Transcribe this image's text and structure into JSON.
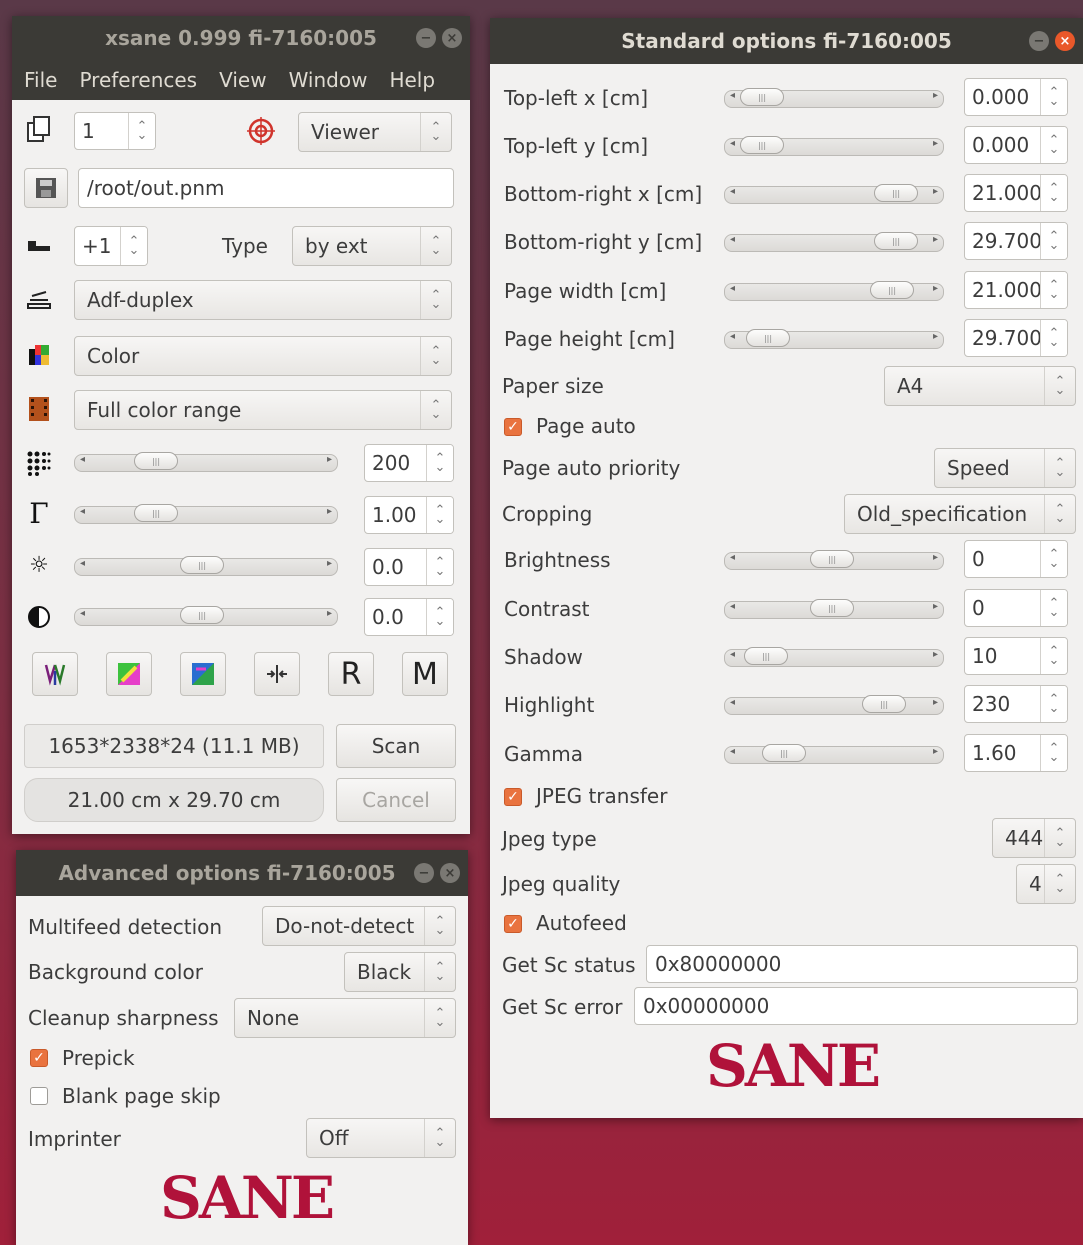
{
  "main": {
    "title": "xsane 0.999 fi-7160:005",
    "menu": [
      "File",
      "Preferences",
      "View",
      "Window",
      "Help"
    ],
    "copies": "1",
    "viewer": "Viewer",
    "filename": "/root/out.pnm",
    "step": "+1",
    "type_label": "Type",
    "type_value": "by ext",
    "source": "Adf-duplex",
    "mode": "Color",
    "range": "Full color range",
    "resolution": "200",
    "gamma": "1.00",
    "brightness": "0.0",
    "contrast": "0.0",
    "info_size": "1653*2338*24 (11.1 MB)",
    "scan": "Scan",
    "info_dim": "21.00 cm x 29.70 cm",
    "cancel": "Cancel"
  },
  "advanced": {
    "title": "Advanced options fi-7160:005",
    "multifeed_label": "Multifeed detection",
    "multifeed_value": "Do-not-detect",
    "bg_label": "Background color",
    "bg_value": "Black",
    "cleanup_label": "Cleanup sharpness",
    "cleanup_value": "None",
    "prepick_label": "Prepick",
    "prepick_checked": true,
    "blank_label": "Blank page skip",
    "blank_checked": false,
    "imprinter_label": "Imprinter",
    "imprinter_value": "Off",
    "logo": "SANE"
  },
  "standard": {
    "title": "Standard options fi-7160:005",
    "tlx_label": "Top-left x [cm]",
    "tlx_value": "0.000",
    "tly_label": "Top-left y [cm]",
    "tly_value": "0.000",
    "brx_label": "Bottom-right x [cm]",
    "brx_value": "21.000",
    "bry_label": "Bottom-right y [cm]",
    "bry_value": "29.700",
    "pw_label": "Page width [cm]",
    "pw_value": "21.000",
    "ph_label": "Page height [cm]",
    "ph_value": "29.700",
    "paper_label": "Paper size",
    "paper_value": "A4",
    "pageauto_label": "Page auto",
    "priority_label": "Page auto priority",
    "priority_value": "Speed",
    "crop_label": "Cropping",
    "crop_value": "Old_specification",
    "bright_label": "Brightness",
    "bright_value": "0",
    "contrast_label": "Contrast",
    "contrast_value": "0",
    "shadow_label": "Shadow",
    "shadow_value": "10",
    "highlight_label": "Highlight",
    "highlight_value": "230",
    "gamma_label": "Gamma",
    "gamma_value": "1.60",
    "jpeg_transfer_label": "JPEG transfer",
    "jpeg_type_label": "Jpeg type",
    "jpeg_type_value": "444",
    "jpeg_quality_label": "Jpeg quality",
    "jpeg_quality_value": "4",
    "autofeed_label": "Autofeed",
    "status_label": "Get Sc status",
    "status_value": "0x80000000",
    "error_label": "Get Sc error",
    "error_value": "0x00000000",
    "logo": "SANE"
  },
  "colors": {
    "accent": "#e9733f",
    "titlebar": "#3b3a36",
    "logo": "#b0123a"
  }
}
